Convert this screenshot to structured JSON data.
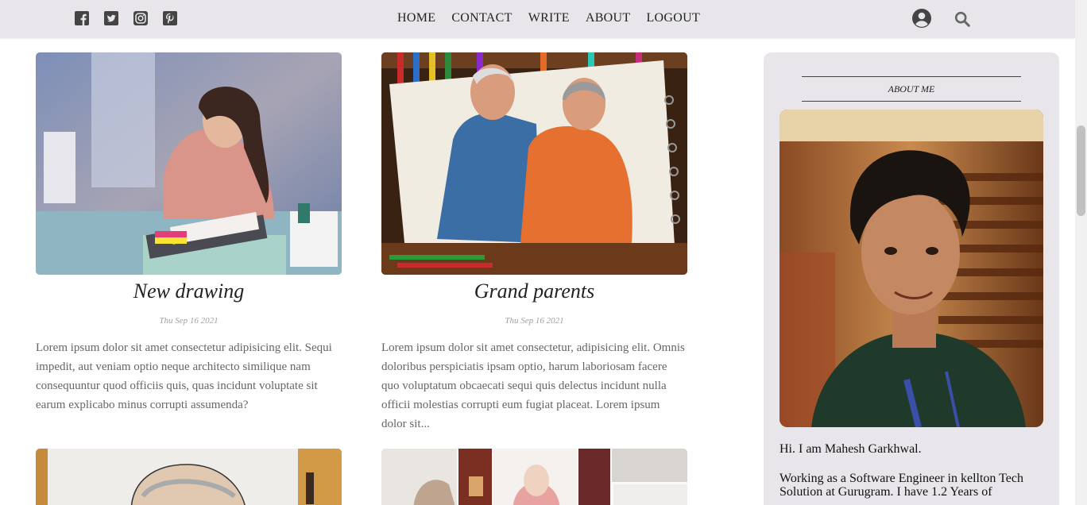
{
  "topbar": {
    "social": [
      "facebook-icon",
      "twitter-icon",
      "instagram-icon",
      "pinterest-icon"
    ],
    "nav": [
      "HOME",
      "CONTACT",
      "WRITE",
      "ABOUT",
      "LOGOUT"
    ],
    "icons": [
      "user-icon",
      "search-icon"
    ]
  },
  "posts": [
    {
      "title": "New drawing",
      "date": "Thu Sep 16 2021",
      "desc": "Lorem ipsum dolor sit amet consectetur adipisicing elit. Sequi impedit, aut veniam optio neque architecto similique nam consequuntur quod officiis quis, quas incidunt voluptate sit earum explicabo minus corrupti assumenda?"
    },
    {
      "title": "Grand parents",
      "date": "Thu Sep 16 2021",
      "desc": "Lorem ipsum dolor sit amet consectetur, adipisicing elit. Omnis doloribus perspiciatis ipsam optio, harum laboriosam facere quo voluptatum obcaecati sequi quis delectus incidunt nulla officii molestias corrupti eum fugiat placeat. Lorem ipsum dolor sit..."
    }
  ],
  "sidebar": {
    "heading": "ABOUT ME",
    "intro": "Hi. I am Mahesh Garkhwal.",
    "bio": "Working as a Software Engineer in kellton Tech Solution at Gurugram. I have 1.2 Years of"
  },
  "colors": {
    "topbar_bg": "#e8e6ea",
    "sidebar_bg": "#e8e6ea",
    "nav_text": "#222222"
  }
}
